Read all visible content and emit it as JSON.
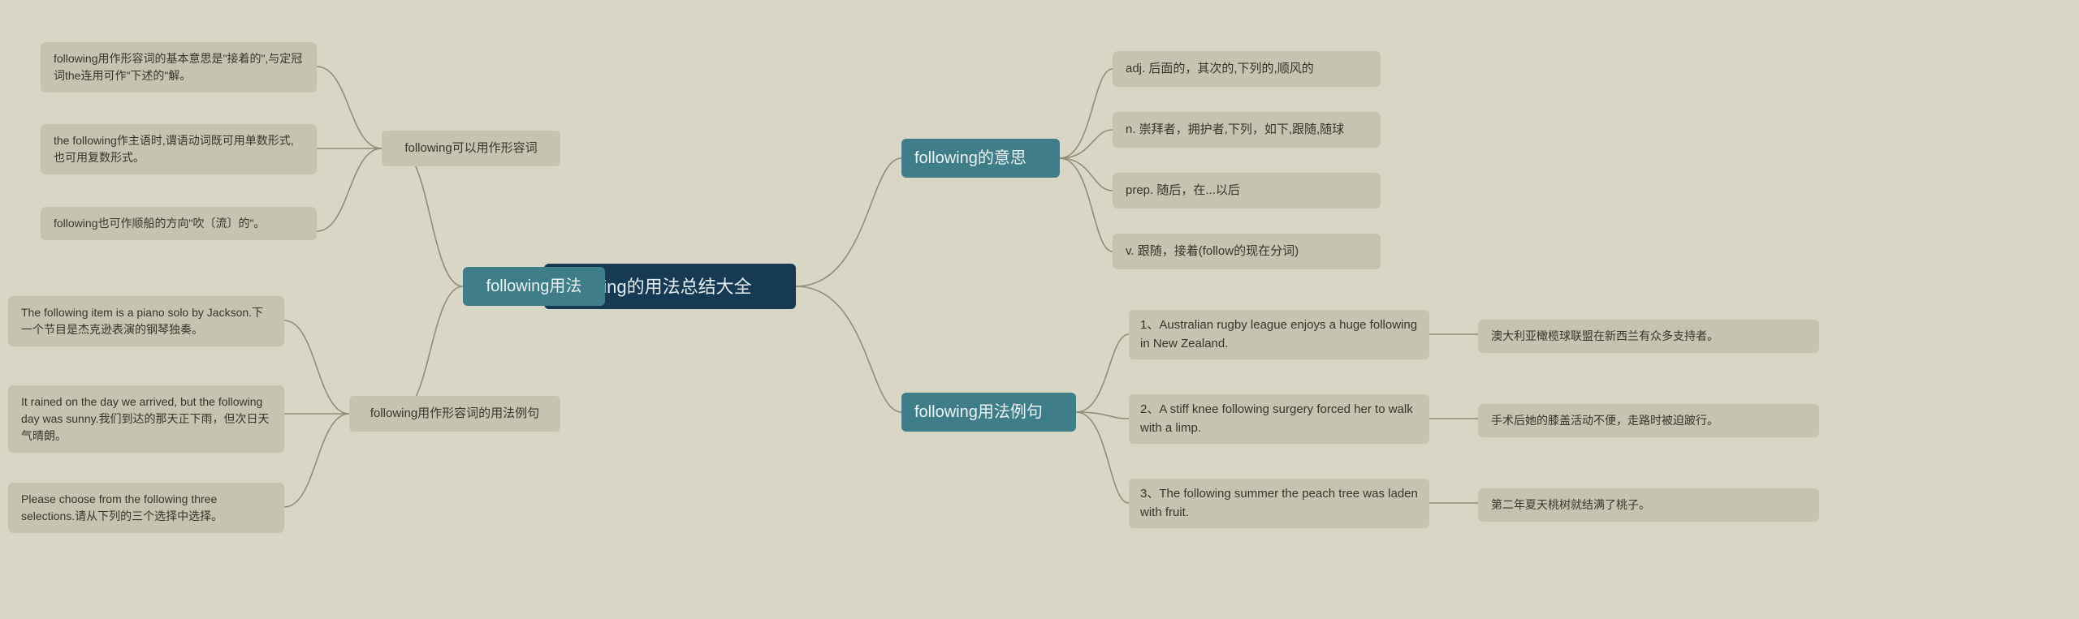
{
  "root": {
    "label": "following的用法总结大全"
  },
  "right": {
    "meaning": {
      "label": "following的意思",
      "items": [
        "adj. 后面的，其次的,下列的,顺风的",
        "n. 崇拜者，拥护者,下列，如下,跟随,随球",
        "prep. 随后，在...以后",
        "v. 跟随，接着(follow的现在分词)"
      ]
    },
    "examples": {
      "label": "following用法例句",
      "items": [
        {
          "en": "1、Australian rugby league enjoys a huge following in New Zealand.",
          "zh": "澳大利亚橄榄球联盟在新西兰有众多支持者。"
        },
        {
          "en": "2、A stiff knee following surgery forced her to walk with a limp.",
          "zh": "手术后她的膝盖活动不便，走路时被迫跛行。"
        },
        {
          "en": "3、The following summer the peach tree was laden with fruit.",
          "zh": "第二年夏天桃树就结满了桃子。"
        }
      ]
    }
  },
  "left": {
    "usage": {
      "label": "following用法",
      "adj": {
        "label": "following可以用作形容词",
        "items": [
          "following用作形容词的基本意思是\"接着的\",与定冠词the连用可作\"下述的\"解。",
          "the following作主语时,谓语动词既可用单数形式,也可用复数形式。",
          "following也可作顺船的方向\"吹〔流〕的\"。"
        ]
      },
      "adjEx": {
        "label": "following用作形容词的用法例句",
        "items": [
          "The following item is a piano solo by Jackson.下一个节目是杰克逊表演的钢琴独奏。",
          "It rained on the day we arrived, but the following day was sunny.我们到达的那天正下雨，但次日天气晴朗。",
          "Please choose from the following three selections.请从下列的三个选择中选择。"
        ]
      }
    }
  }
}
